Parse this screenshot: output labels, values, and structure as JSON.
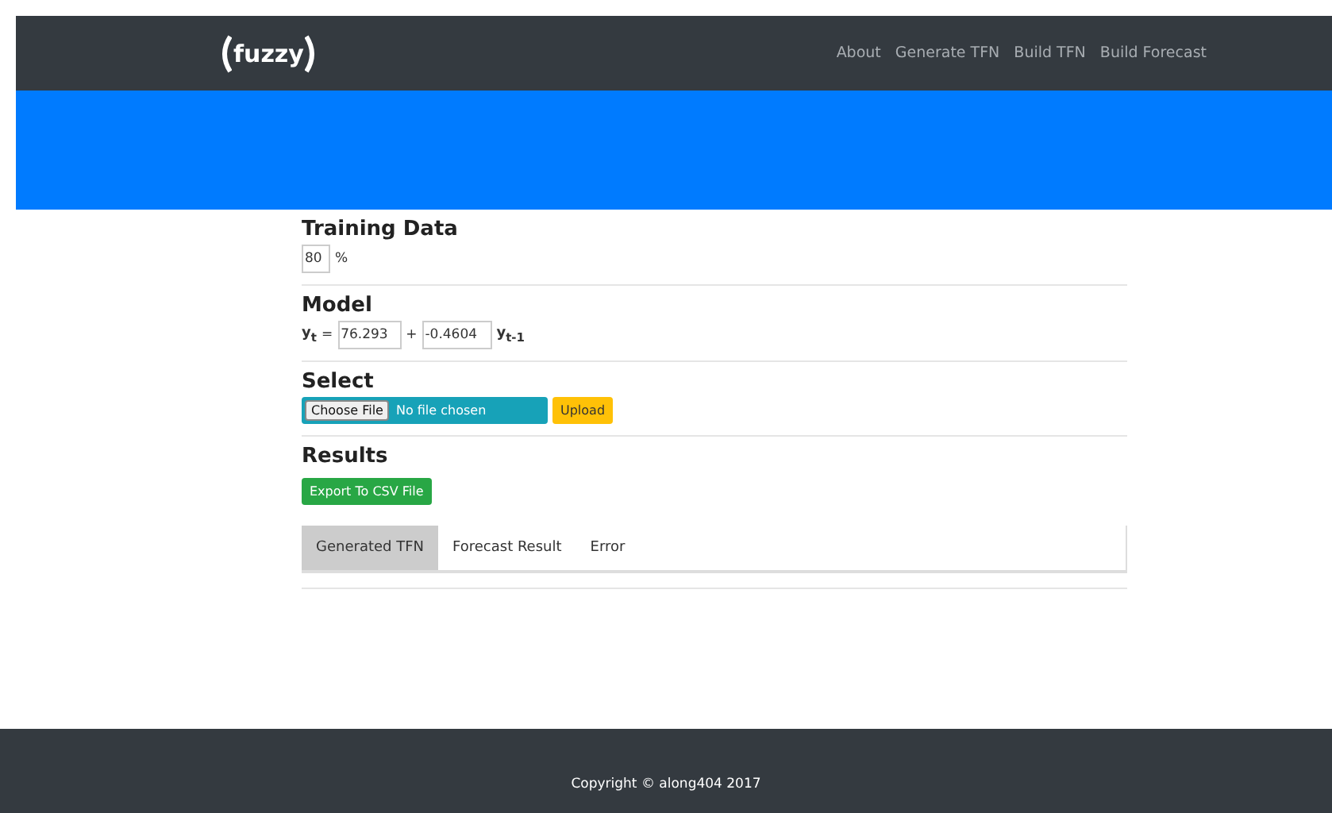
{
  "navbar": {
    "logo": "fuzzy",
    "links": [
      "About",
      "Generate TFN",
      "Build TFN",
      "Build Forecast"
    ]
  },
  "training": {
    "heading": "Training Data",
    "value": "80",
    "unit": "%"
  },
  "model": {
    "heading": "Model",
    "lhs": "y$_{t}$",
    "equals": "=",
    "intercept": "76.293",
    "plus": "+",
    "coefficient": "-0.4604",
    "rhs": "y$_{t-1}$"
  },
  "select": {
    "heading": "Select",
    "choose_button": "Choose File",
    "file_status": "No file chosen",
    "upload_button": "Upload"
  },
  "results": {
    "heading": "Results",
    "export_button": "Export To CSV File",
    "tabs": [
      {
        "label": "Generated TFN",
        "selected": true
      },
      {
        "label": "Forecast Result",
        "selected": false
      },
      {
        "label": "Error",
        "selected": false
      }
    ]
  },
  "footer": {
    "text": "Copyright © along404 2017"
  }
}
